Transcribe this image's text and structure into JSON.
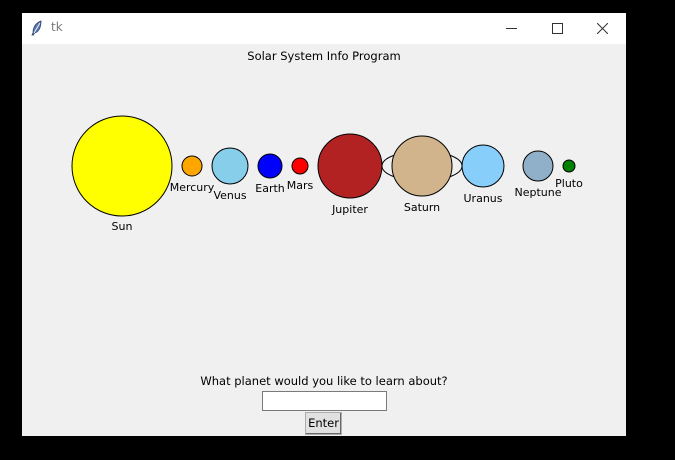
{
  "window": {
    "title": "tk",
    "icon": "feather-icon",
    "controls": [
      "minimize-icon",
      "maximize-icon",
      "close-icon"
    ]
  },
  "header": "Solar System Info Program",
  "bodies": [
    {
      "name": "Sun",
      "color": "#ffff00"
    },
    {
      "name": "Mercury",
      "color": "#ffa500"
    },
    {
      "name": "Venus",
      "color": "#87ceeb"
    },
    {
      "name": "Earth",
      "color": "#0000ff"
    },
    {
      "name": "Mars",
      "color": "#ff0000"
    },
    {
      "name": "Jupiter",
      "color": "#b22222"
    },
    {
      "name": "Saturn",
      "color": "#d2b48c"
    },
    {
      "name": "Uranus",
      "color": "#87cefa"
    },
    {
      "name": "Neptune",
      "color": "#8fb0c8"
    },
    {
      "name": "Pluto",
      "color": "#008000"
    }
  ],
  "prompt": "What planet would you like to learn about?",
  "input": {
    "value": "",
    "placeholder": ""
  },
  "enter_label": "Enter"
}
